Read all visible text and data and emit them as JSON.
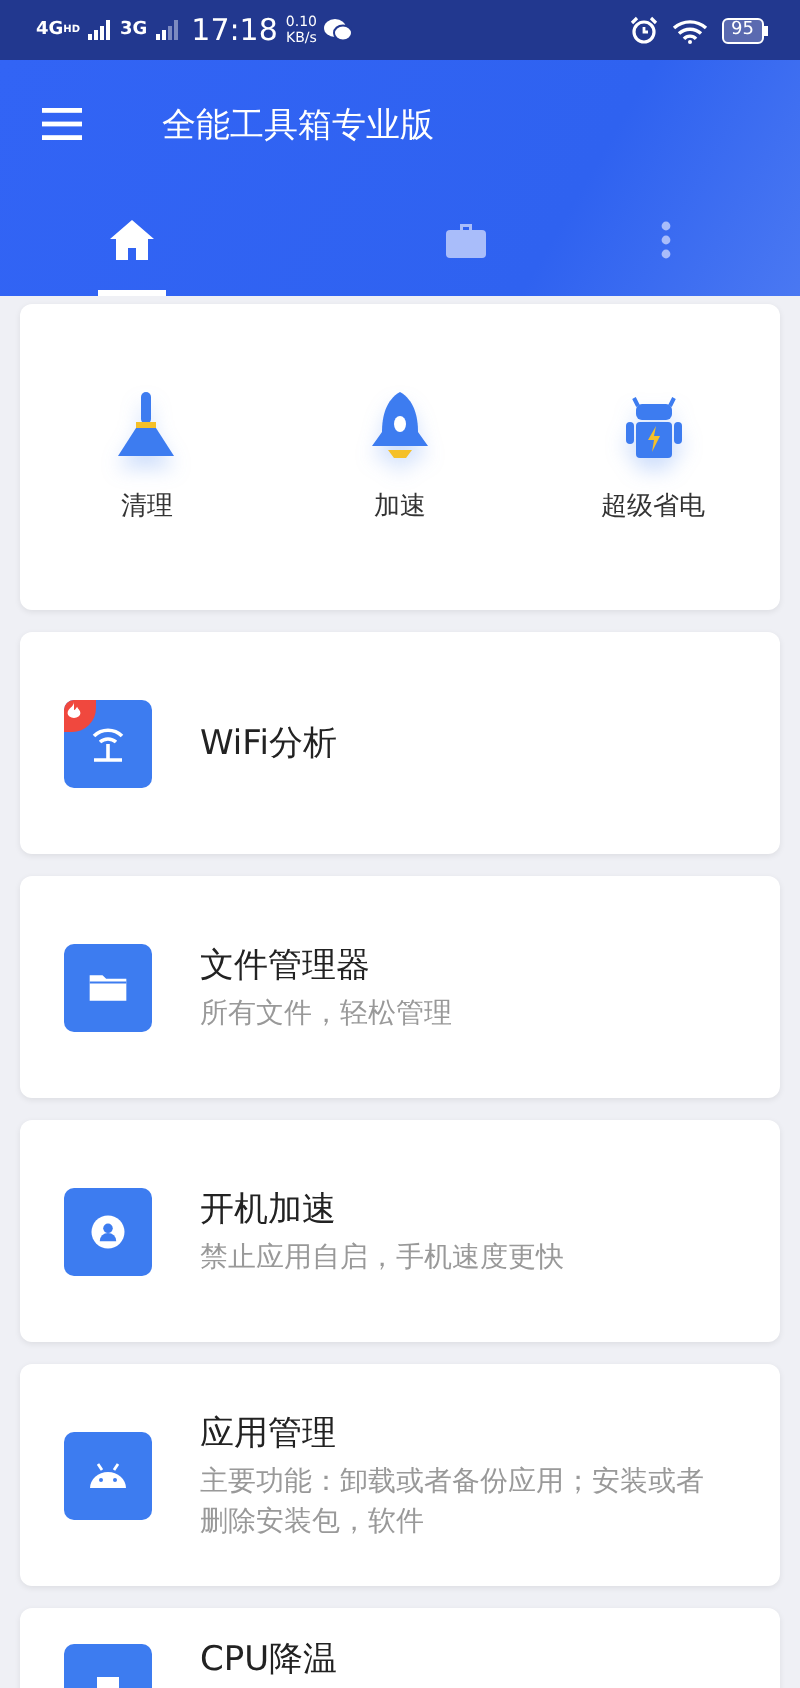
{
  "status_bar": {
    "network_1": "4G",
    "network_1_badge": "HD",
    "network_2": "3G",
    "time": "17:18",
    "speed_value": "0.10",
    "speed_unit": "KB/s",
    "battery": "95"
  },
  "app_bar": {
    "title": "全能工具箱专业版"
  },
  "tabs": [
    {
      "selected": true
    },
    {
      "selected": false
    },
    {
      "selected": false
    }
  ],
  "quick_actions": [
    {
      "label": "清理"
    },
    {
      "label": "加速"
    },
    {
      "label": "超级省电"
    }
  ],
  "tools": [
    {
      "title": "WiFi分析",
      "hot": true
    },
    {
      "title": "文件管理器",
      "subtitle": "所有文件，轻松管理",
      "hot": false
    },
    {
      "title": "开机加速",
      "subtitle": "禁止应用自启，手机速度更快",
      "hot": false
    },
    {
      "title": "应用管理",
      "subtitle": "主要功能：卸载或者备份应用；安装或者删除安装包，软件",
      "hot": false
    },
    {
      "title": "CPU降温",
      "hot": false
    }
  ]
}
